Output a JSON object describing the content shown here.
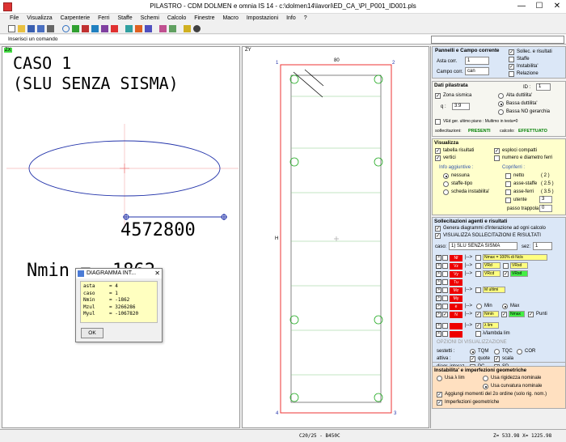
{
  "window": {
    "title": "PILASTRO - CDM DOLMEN e omnia IS 14 - c:\\dolmen14\\lavori\\ED_CA_\\PI_P001_ID001.pls",
    "minimize": "—",
    "maximize": "☐",
    "close": "✕"
  },
  "menu": [
    "File",
    "Visualizza",
    "Carpenterie",
    "Ferri",
    "Staffe",
    "Schemi",
    "Calcolo",
    "Finestre",
    "Macro",
    "Impostazioni",
    "Info",
    "?"
  ],
  "command": {
    "label": "Inserisci un comando",
    "value": ""
  },
  "left_view": {
    "tag": "ZX",
    "caso_line1": "CASO 1",
    "caso_line2": "(SLU SENZA SISMA)",
    "dimension_value": "4572800",
    "nmin_text": "Nmin = -1862"
  },
  "dialog": {
    "title": "DIAGRAMMA INT...",
    "close": "✕",
    "rows": [
      {
        "k": "asta",
        "v": "4"
      },
      {
        "k": "caso",
        "v": "1"
      },
      {
        "k": "Nmin",
        "v": "-1862"
      },
      {
        "k": "Mzul",
        "v": "3266286"
      },
      {
        "k": "Myul",
        "v": "-1067820"
      }
    ],
    "ok": "OK"
  },
  "mid_view": {
    "tag": "ZY",
    "corner_tl": "1",
    "corner_tr": "2",
    "corner_bl": "4",
    "corner_br": "3",
    "top_label": "80",
    "side_label": "H"
  },
  "panel_pannelli": {
    "title": "Pannelli e Campo corrente",
    "asta_label": "Asta corr.",
    "asta_value": "1",
    "campo_label": "Campo corr.",
    "campo_value": "can",
    "checks": [
      {
        "label": "Sollec. e risultati",
        "checked": true
      },
      {
        "label": "Staffe",
        "checked": false
      },
      {
        "label": "Instabilita'",
        "checked": true
      },
      {
        "label": "Relazione",
        "checked": false
      }
    ]
  },
  "panel_dati": {
    "title": "Dati pilastrata",
    "id_label": "ID :",
    "id_value": "1",
    "zona_label": "Zona sismica",
    "q_label": "q :",
    "q_value": "3.9",
    "duttilita": [
      "Alta duttilita'",
      "Bassa duttilita'",
      "Bassa NO gerarchia"
    ],
    "ved_label": "VEd ger. ultimo piano : Multimo in testa=0",
    "sollecitazioni_label": "sollecitazioni:",
    "sollecitazioni_value": "PRESENTI",
    "calcolo_label": "calcolo:",
    "calcolo_value": "EFFETTUATO"
  },
  "panel_visualizza": {
    "title": "Visualizza",
    "checks": [
      {
        "label": "tabella risultati",
        "checked": true
      },
      {
        "label": "esploci compatti",
        "checked": true
      },
      {
        "label": "vertici",
        "checked": true
      },
      {
        "label": "numero e diametro ferri",
        "checked": false
      }
    ],
    "info_title": "Info aggiuntive :",
    "info_options": [
      "nessuna",
      "staffe-tipo",
      "scheda instabilita'"
    ],
    "copriferri_title": "Copriferri :",
    "copriferri": [
      {
        "label": "netto",
        "value": "( 2 )"
      },
      {
        "label": "asse-staffe",
        "value": "( 2.5 )"
      },
      {
        "label": "asse-ferri",
        "value": "( 3.5 )"
      },
      {
        "label": "utente",
        "value": "3"
      }
    ],
    "passo_label": "passo trappola",
    "passo_value": "0"
  },
  "panel_sollecitazioni": {
    "title": "Sollecitazioni agenti e risultati",
    "checks": [
      {
        "label": "Genera diagrammi d'interazione ad ogni calcolo",
        "checked": true
      },
      {
        "label": "VISUALIZZA SOLLECITAZIONI E RISULTATI",
        "checked": true
      }
    ],
    "caso_label": "caso:",
    "caso_value": "1) SLU SENZA SISMA",
    "sez_label": "sez:",
    "sez_value": "1",
    "rows": [
      "Nf",
      "Vz",
      "Vy",
      "Tu",
      "Mz",
      "My",
      "e",
      "N"
    ],
    "nmax_box": "Nmax = 100% di Ncls",
    "vrd": "VRd",
    "vrsd": "VRsd",
    "vrcd": "VRcd",
    "vrsd_g": "VRsd",
    "multimi": "M ultimi",
    "min": "Min",
    "max": "Max",
    "nmin": "Nmin",
    "nmax": "Nmax",
    "punti": "Punti",
    "lambda": "λ lim",
    "lambda2": "λ/lambda lim",
    "opzioni_title": "OPZIONI DI VISUALIZZAZIONE",
    "sestetti_label": "sestetti :",
    "sestetti": [
      "TQM",
      "TQC",
      "COR"
    ],
    "attiva_label": "attiva :",
    "attiva": [
      {
        "label": "quote",
        "checked": true
      },
      {
        "label": "scala",
        "checked": true
      }
    ],
    "diag_label": "diagr. interaz.",
    "diag": [
      {
        "label": "PC",
        "checked": false
      },
      {
        "label": "SD",
        "checked": true
      }
    ]
  },
  "panel_instabilita": {
    "title": "Instabilita' e imperfezioni geometriche",
    "radios": [
      "Usa λ lim",
      "Usa rigidezza nominale",
      "Usa curvatura nominale"
    ],
    "checks": [
      {
        "label": "Aggiungi momenti del 2o ordine (solo rig. nom.)",
        "checked": true
      },
      {
        "label": "Imperfezioni geometriche",
        "checked": true
      }
    ]
  },
  "status": {
    "materials": "C20/25 - B450C",
    "coords": "Z= 533.98  X= 1225.98"
  },
  "colors": {
    "highlight_yellow": "#ffffcc",
    "panel_orange": "#ffe0c0",
    "panel_blue": "#dbe7f7",
    "red": "#ee0000",
    "green": "#33ee33"
  }
}
